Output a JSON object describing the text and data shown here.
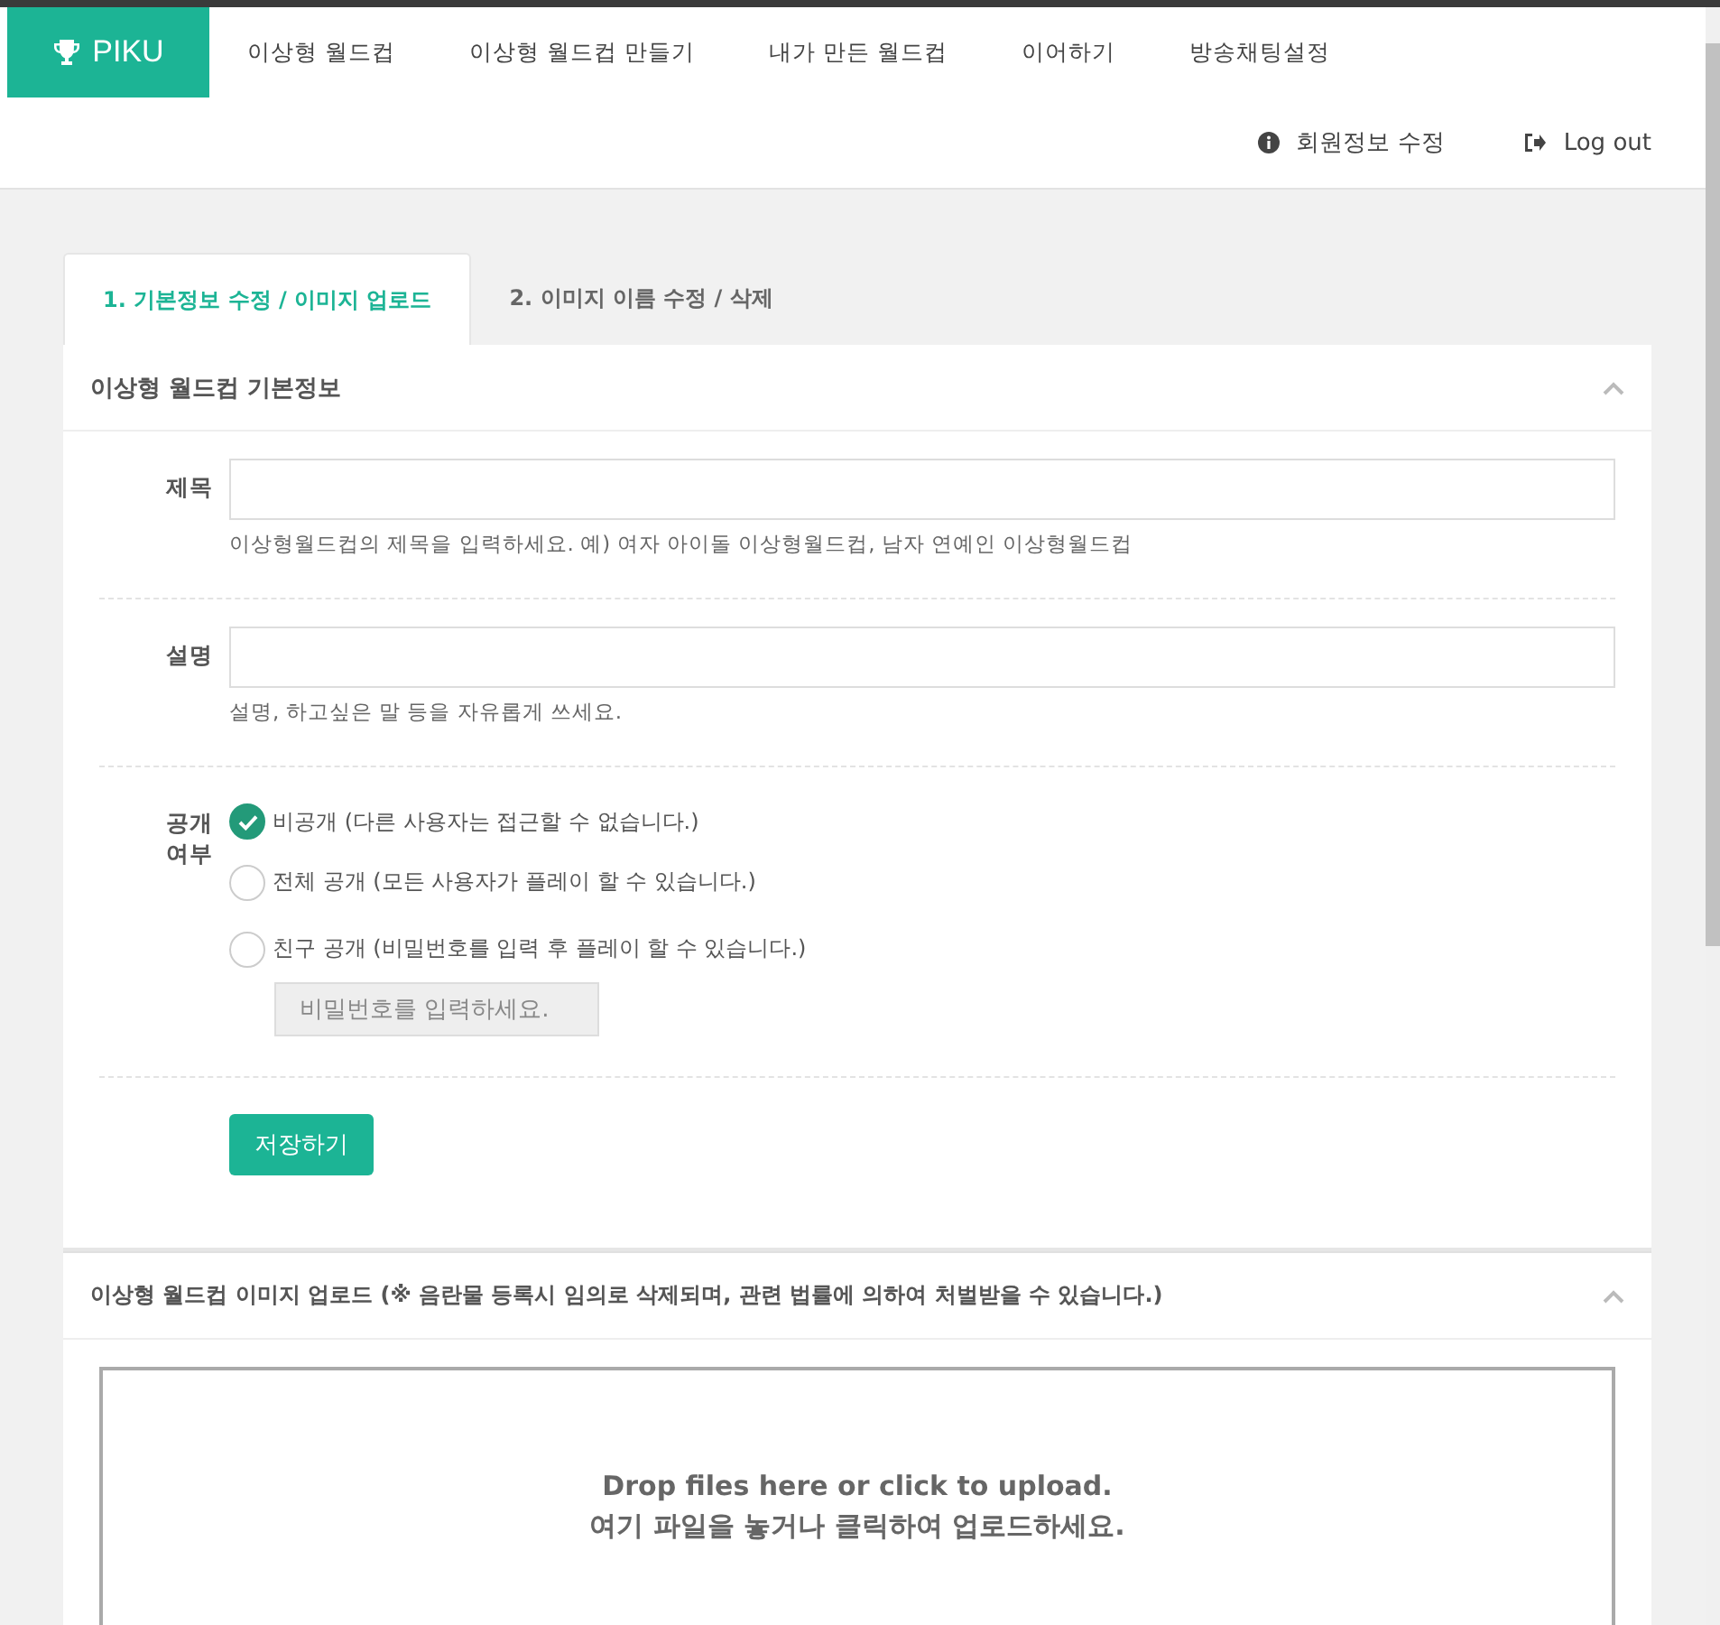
{
  "brand": "PIKU",
  "nav": [
    {
      "label": "이상형 월드컵"
    },
    {
      "label": "이상형 월드컵 만들기"
    },
    {
      "label": "내가 만든 월드컵"
    },
    {
      "label": "이어하기"
    },
    {
      "label": "방송채팅설정"
    }
  ],
  "user_links": [
    {
      "kind": "info",
      "label": "회원정보 수정"
    },
    {
      "kind": "logout",
      "label": "Log out"
    }
  ],
  "tabs": [
    {
      "label": "1. 기본정보 수정 / 이미지 업로드",
      "selected": true
    },
    {
      "label": "2. 이미지 이름 수정 / 삭제",
      "selected": false
    }
  ],
  "basic_panel": {
    "title": "이상형 월드컵 기본정보",
    "expanded": true,
    "fields": [
      {
        "label": "제목",
        "help": "이상형월드컵의 제목을 입력하세요. 예) 여자 아이돌 이상형월드컵, 남자 연예인 이상형월드컵"
      },
      {
        "label": "설명",
        "help": "설명, 하고싶은 말 등을 자유롭게 쓰세요."
      }
    ],
    "visibility": {
      "label": "공개 여부",
      "options": [
        {
          "label": "비공개 (다른 사용자는 접근할 수 없습니다.)",
          "selected": true
        },
        {
          "label": "전체 공개 (모든 사용자가 플레이 할 수 있습니다.)",
          "selected": false
        },
        {
          "label": "친구 공개 (비밀번호를 입력 후 플레이 할 수 있습니다.)",
          "selected": false
        }
      ],
      "password": {
        "placeholder": "비밀번호를 입력하세요.",
        "disabled": true
      }
    },
    "save_button": "저장하기"
  },
  "upload_panel": {
    "title": "이상형 월드컵 이미지 업로드 (※ 음란물 등록시 임의로 삭제되며, 관련 법률에 의하여 처벌받을 수 있습니다.)",
    "expanded": true,
    "dropzone": [
      "Drop files here or click to upload.",
      "여기 파일을 놓거나 클릭하여 업로드하세요."
    ]
  }
}
